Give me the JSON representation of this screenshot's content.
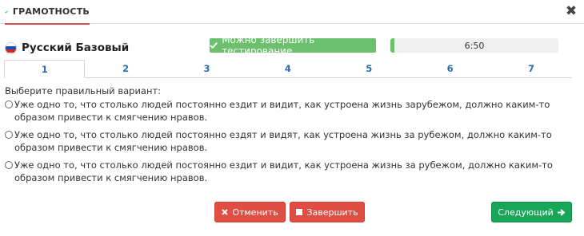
{
  "header": {
    "title": "ГРАМОТНОСТЬ",
    "icon": "check-pencil-icon",
    "accent_color": "#d9534f"
  },
  "test": {
    "flag": "russia-flag",
    "name": "Русский Базовый"
  },
  "status": {
    "finish_available_label": "Можно завершить тестирование",
    "finish_available_color": "#6cbf6c"
  },
  "timer": {
    "value": "6:50"
  },
  "tabs": [
    {
      "label": "1",
      "active": true
    },
    {
      "label": "2",
      "active": false
    },
    {
      "label": "3",
      "active": false
    },
    {
      "label": "4",
      "active": false
    },
    {
      "label": "5",
      "active": false
    },
    {
      "label": "6",
      "active": false
    },
    {
      "label": "7",
      "active": false
    }
  ],
  "question": {
    "prompt": "Выберите правильный вариант:",
    "options": [
      {
        "text": "Уже одно то, что столько людей постоянно ездит и видит, как устроена жизнь зарубежом, должно каким-то образом привести к смягчению нравов.",
        "selected": false
      },
      {
        "text": "Уже одно то, что столько людей постоянно ездят и видят, как устроена жизнь за рубежом, должно каким-то образом привести к смягчению нравов.",
        "selected": false
      },
      {
        "text": "Уже одно то, что столько людей постоянно ездит и видит, как устроена жизнь за рубежом, должно каким-то образом привести к смягчению нравов.",
        "selected": false
      }
    ]
  },
  "buttons": {
    "cancel": "Отменить",
    "finish": "Завершить",
    "next": "Следующий",
    "danger_color": "#e04d42",
    "success_color": "#18a659"
  }
}
